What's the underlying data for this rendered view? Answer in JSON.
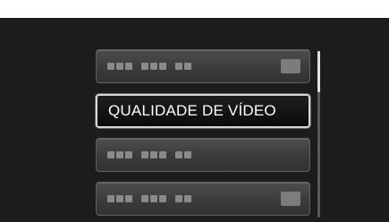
{
  "menu": {
    "items": [
      {
        "label": "",
        "state": "disabled",
        "has_value_box": true
      },
      {
        "label": "QUALIDADE DE VÍDEO",
        "state": "selected",
        "has_value_box": false
      },
      {
        "label": "",
        "state": "disabled",
        "has_value_box": false
      },
      {
        "label": "",
        "state": "disabled",
        "has_value_box": true
      }
    ]
  },
  "scrollbar": {
    "position_fraction": 0.0,
    "visible_fraction": 0.25
  },
  "colors": {
    "screen_bg": "#1c1c1c",
    "item_bg": "#3f3f3f",
    "selected_bg": "#0c0c0c",
    "selected_border": "#d8d8d8",
    "text": "#ffffff"
  }
}
